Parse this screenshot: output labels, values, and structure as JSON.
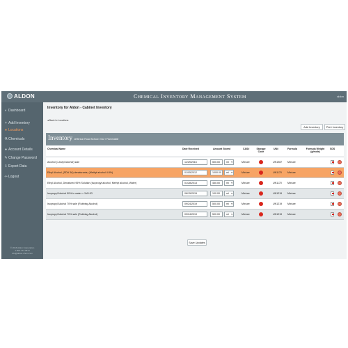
{
  "header": {
    "brand": "ALDON",
    "system_title": "Chemical Inventory Management System",
    "user": "aldon"
  },
  "sidebar": {
    "items": [
      {
        "label": "Dashboard",
        "icon": "dashboard-icon",
        "glyph": "◐"
      },
      {
        "label": "Add Inventory",
        "icon": "plus-icon",
        "glyph": "+"
      },
      {
        "label": "Locations",
        "icon": "location-icon",
        "glyph": "●"
      },
      {
        "label": "Chemicals",
        "icon": "flask-icon",
        "glyph": "⚗"
      },
      {
        "label": "Account Details",
        "icon": "user-icon",
        "glyph": "●"
      },
      {
        "label": "Change Password",
        "icon": "key-icon",
        "glyph": "✎"
      },
      {
        "label": "Export Data",
        "icon": "export-icon",
        "glyph": "⇩"
      },
      {
        "label": "Logout",
        "icon": "logout-icon",
        "glyph": "⇦"
      }
    ],
    "footer_line1": "© 2016 Aldon Corporation",
    "footer_line2": "1-800-724-0814",
    "footer_line3": "info@aldon-chem.com"
  },
  "main": {
    "page_title": "Inventory for Aldon - Cabinet Inventory",
    "back_link": "◂ Back to Locations",
    "add_inventory_label": "Add Inventory",
    "print_inventory_label": "Print Inventory",
    "inventory_title": "Inventory",
    "inventory_subtitle": "Jefferson Road School / 012 / Flammable",
    "save_label": "Save Updates"
  },
  "table": {
    "headers": {
      "name": "Chemical Name",
      "date": "Date Received",
      "amount": "Amount Stored",
      "cas": "CAS#",
      "storage": "Storage Code",
      "un": "UN#",
      "formula": "Formula",
      "weight": "Formula Weight (g/mole)",
      "sds": "SDS"
    },
    "rows": [
      {
        "name": "Alcohol (1-butyl Alcohol) sale",
        "date": "11/29/2016",
        "amount": "500.00",
        "unit": "ml",
        "cas": "Mixture",
        "un": "UN1987",
        "formula": "Mixture"
      },
      {
        "name": "Ethyl Alcohol, (SDA 3A) denaturants, (Methyl alcohol 4.8%)",
        "date": "01/05/2012",
        "amount": "1000.00",
        "unit": "ml",
        "cas": "Mixture",
        "un": "UN1170",
        "formula": "Mixture"
      },
      {
        "name": "Ethyl Alcohol, Denatured 95% Solution (Isopropyl alcohol, Methyl alcohol, Water)",
        "date": "01/28/2013",
        "amount": "450.00",
        "unit": "ml",
        "cas": "Mixture",
        "un": "UN1170",
        "formula": "Mixture"
      },
      {
        "name": "Isopropyl Alcohol 50% in water = 1M HCl",
        "date": "06/15/2015",
        "amount": "100.00",
        "unit": "ml",
        "cas": "Mixture",
        "un": "UN1219",
        "formula": "Mixture"
      },
      {
        "name": "Isopropyl Alcohol 70% sale (Rubbing Alcohol)",
        "date": "09/24/2019",
        "amount": "500.00",
        "unit": "ml",
        "cas": "Mixture",
        "un": "UN1219",
        "formula": "Mixture"
      },
      {
        "name": "Isopropyl Alcohol 70% sale (Rubbing Alcohol)",
        "date": "09/24/2019",
        "amount": "500.00",
        "unit": "ml",
        "cas": "Mixture",
        "un": "UN1219",
        "formula": "Mixture"
      }
    ]
  },
  "colors": {
    "accent": "#f7a464",
    "header": "#5f6f78",
    "storage_red": "#d9261c"
  }
}
